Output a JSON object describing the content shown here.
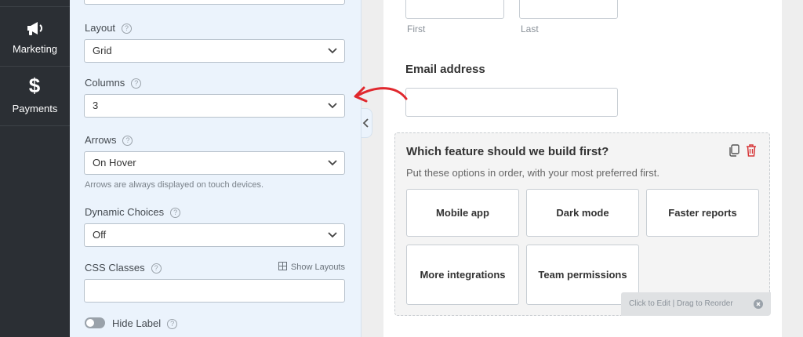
{
  "nav": {
    "items": [
      {
        "label": "Marketing",
        "icon": "megaphone-icon"
      },
      {
        "label": "Payments",
        "icon": "dollar-icon"
      }
    ]
  },
  "panel": {
    "layout": {
      "label": "Layout",
      "value": "Grid"
    },
    "columns": {
      "label": "Columns",
      "value": "3"
    },
    "arrows": {
      "label": "Arrows",
      "value": "On Hover",
      "hint": "Arrows are always displayed on touch devices."
    },
    "dynamic_choices": {
      "label": "Dynamic Choices",
      "value": "Off"
    },
    "css_classes": {
      "label": "CSS Classes",
      "show_layouts": "Show Layouts",
      "value": ""
    },
    "hide_label": {
      "label": "Hide Label",
      "on": false
    },
    "help_glyph": "?"
  },
  "preview": {
    "name": {
      "first": "First",
      "last": "Last"
    },
    "email": {
      "label": "Email address",
      "value": ""
    },
    "ranking": {
      "title": "Which feature should we build first?",
      "description": "Put these options in order, with your most preferred first.",
      "options": [
        "Mobile app",
        "Dark mode",
        "Faster reports",
        "More integrations",
        "Team permissions"
      ],
      "edit_hint": "Click to Edit  |  Drag to Reorder"
    }
  },
  "colors": {
    "nav_bg": "#2b2f34",
    "panel_bg": "#ebf3fc",
    "annotation_arrow": "#e0282e",
    "trash_red": "#d63638"
  }
}
